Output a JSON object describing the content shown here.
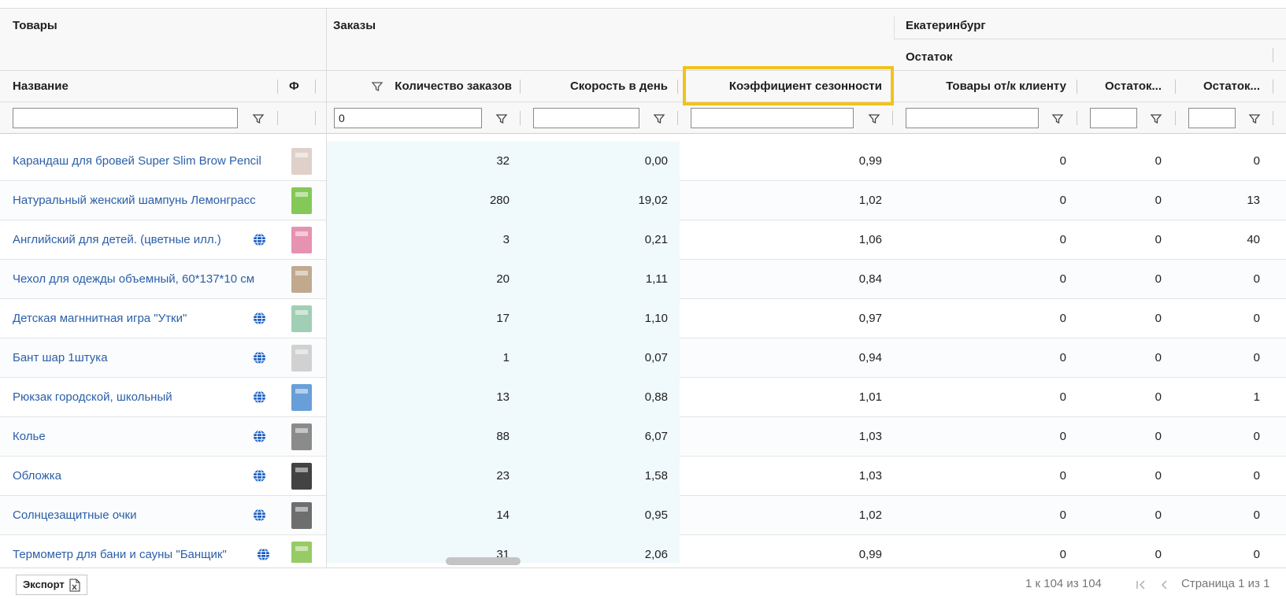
{
  "header": {
    "group_goods": "Товары",
    "group_orders": "Заказы",
    "group_city": "Екатеринбург",
    "subgroup_stock": "Остаток"
  },
  "columns": {
    "name": "Название",
    "photo": "Ф",
    "order_count": "Количество заказов",
    "speed_per_day": "Скорость в день",
    "seasonality": "Коэффициент сезонности",
    "goods_to_client": "Товары от/к клиенту",
    "stock_a": "Остаток...",
    "stock_b": "Остаток..."
  },
  "filters": {
    "name": "",
    "order_count": "0",
    "speed_per_day": "",
    "seasonality": "",
    "goods_to_client": "",
    "stock_a": "",
    "stock_b": ""
  },
  "rows": [
    {
      "name": "Карандаш для бровей Super Slim Brow Pencil",
      "globe": false,
      "thumb": "brow-pencil-thumbnail",
      "orders": "32",
      "speed": "0,00",
      "season": "0,99",
      "to_client": "0",
      "stock_a": "0",
      "stock_b": "0"
    },
    {
      "name": "Натуральный женский шампунь Лемонграсс",
      "globe": false,
      "thumb": "shampoo-thumbnail",
      "orders": "280",
      "speed": "19,02",
      "season": "1,02",
      "to_client": "0",
      "stock_a": "0",
      "stock_b": "13"
    },
    {
      "name": "Английский для детей. (цветные илл.)",
      "globe": true,
      "thumb": "book-thumbnail",
      "orders": "3",
      "speed": "0,21",
      "season": "1,06",
      "to_client": "0",
      "stock_a": "0",
      "stock_b": "40"
    },
    {
      "name": "Чехол для одежды объемный, 60*137*10 см",
      "globe": false,
      "thumb": "garment-cover-thumbnail",
      "orders": "20",
      "speed": "1,11",
      "season": "0,84",
      "to_client": "0",
      "stock_a": "0",
      "stock_b": "0"
    },
    {
      "name": "Детская магннитная игра \"Утки\"",
      "globe": true,
      "thumb": "magnetic-game-thumbnail",
      "orders": "17",
      "speed": "1,10",
      "season": "0,97",
      "to_client": "0",
      "stock_a": "0",
      "stock_b": "0"
    },
    {
      "name": "Бант шар 1штука",
      "globe": true,
      "thumb": "bow-thumbnail",
      "orders": "1",
      "speed": "0,07",
      "season": "0,94",
      "to_client": "0",
      "stock_a": "0",
      "stock_b": "0"
    },
    {
      "name": "Рюкзак городской, школьный",
      "globe": true,
      "thumb": "backpack-thumbnail",
      "orders": "13",
      "speed": "0,88",
      "season": "1,01",
      "to_client": "0",
      "stock_a": "0",
      "stock_b": "1"
    },
    {
      "name": "Колье",
      "globe": true,
      "thumb": "necklace-thumbnail",
      "orders": "88",
      "speed": "6,07",
      "season": "1,03",
      "to_client": "0",
      "stock_a": "0",
      "stock_b": "0"
    },
    {
      "name": "Обложка",
      "globe": true,
      "thumb": "cover-thumbnail",
      "orders": "23",
      "speed": "1,58",
      "season": "1,03",
      "to_client": "0",
      "stock_a": "0",
      "stock_b": "0"
    },
    {
      "name": "Солнцезащитные очки",
      "globe": true,
      "thumb": "sunglasses-thumbnail",
      "orders": "14",
      "speed": "0,95",
      "season": "1,02",
      "to_client": "0",
      "stock_a": "0",
      "stock_b": "0"
    },
    {
      "name": "Термометр для бани и сауны \"Банщик\"",
      "globe": true,
      "thumb": "thermometer-thumbnail",
      "orders": "31",
      "speed": "2,06",
      "season": "0,99",
      "to_client": "0",
      "stock_a": "0",
      "stock_b": "0"
    }
  ],
  "footer": {
    "export_label": "Экспорт",
    "range_text": "1 к 104 из 104",
    "page_text": "Страница 1 из 1"
  },
  "colors": {
    "link": "#2b5fa8",
    "highlight": "#f1c21b",
    "tint": "#f0f9fc",
    "globe": "#1c5fc4"
  }
}
